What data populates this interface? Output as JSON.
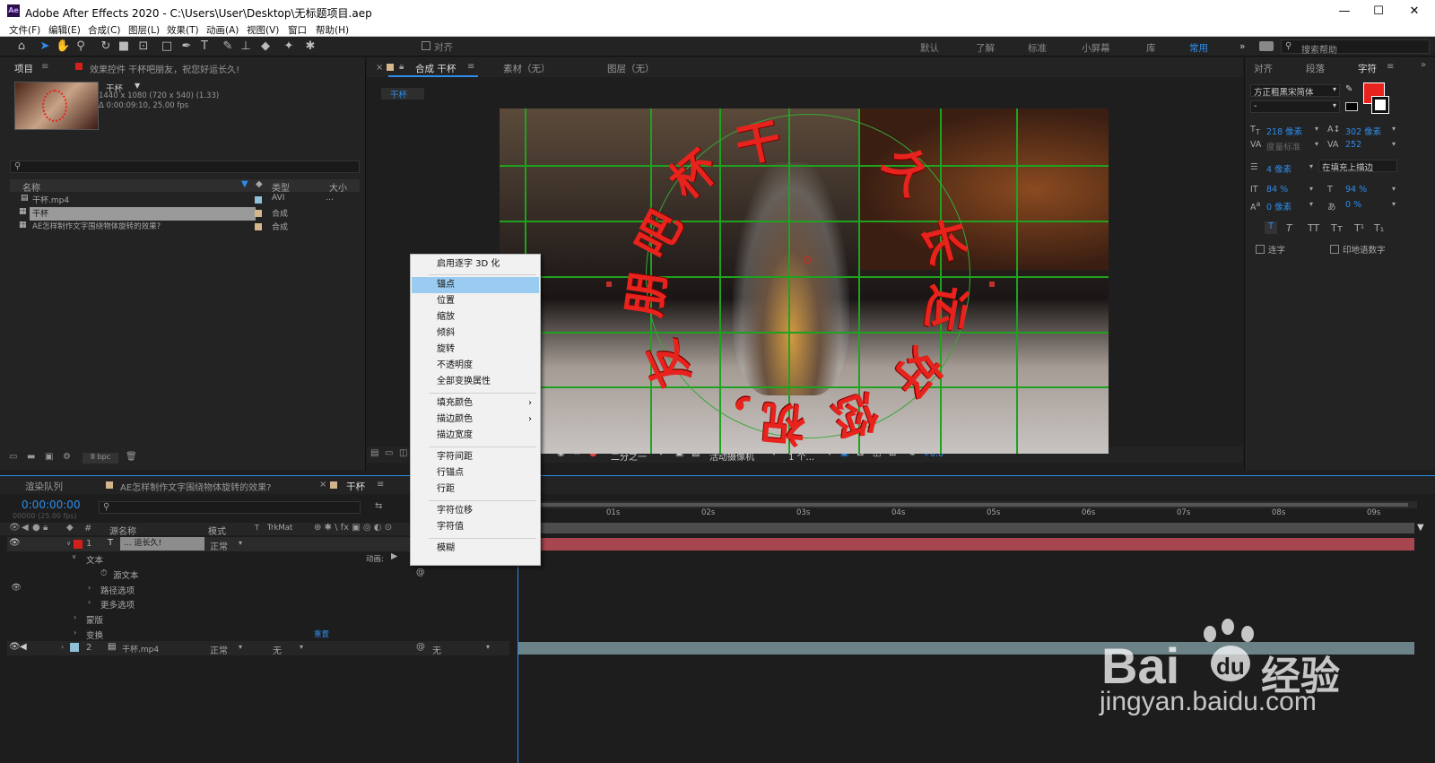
{
  "window": {
    "title": "Adobe After Effects 2020 - C:\\Users\\User\\Desktop\\无标题项目.aep",
    "app_badge": "Ae",
    "minimize": "—",
    "maximize": "☐",
    "close": "✕"
  },
  "menu": [
    "文件(F)",
    "编辑(E)",
    "合成(C)",
    "图层(L)",
    "效果(T)",
    "动画(A)",
    "视图(V)",
    "窗口",
    "帮助(H)"
  ],
  "toolbar": {
    "align_label": "对齐",
    "workspaces": [
      "默认",
      "了解",
      "标准",
      "小屏幕",
      "库",
      "常用"
    ],
    "workspaces_more": "»",
    "search_placeholder": "搜索帮助"
  },
  "project_panel": {
    "tab": "项目",
    "effects_tab": "效果控件 干杯吧朋友，祝您好运长久!",
    "item_name": "干杯",
    "item_info1": "1440 x 1080  (720 x 540) (1.33)",
    "item_info2": "Δ 0:00:09:10, 25.00 fps",
    "columns": [
      "名称",
      "类型",
      "大小"
    ],
    "items": [
      {
        "name": "干杯.mp4",
        "type": "AVI",
        "size": "…"
      },
      {
        "name": "干杯",
        "type": "合成",
        "size": ""
      },
      {
        "name": "AE怎样制作文字围绕物体旋转的效果?",
        "type": "合成",
        "size": ""
      }
    ],
    "bpc": "8 bpc"
  },
  "comp_panel": {
    "tabs": [
      "合成 干杯",
      "素材（无）",
      "图层（无）"
    ],
    "breadcrumb": "干杯",
    "zoom_label": "二分之一",
    "camera": "活动摄像机",
    "views": "1 个...",
    "exposure": "+0.0",
    "ring_text": [
      "干",
      "杯",
      "吧",
      "朋",
      "友",
      "，",
      "祝",
      "您",
      "好",
      "运",
      "长",
      "久"
    ]
  },
  "context_menu": {
    "items": [
      {
        "label": "启用逐字 3D 化",
        "sub": false
      },
      {
        "label": "锚点",
        "sub": false,
        "highlighted": true
      },
      {
        "label": "位置",
        "sub": false
      },
      {
        "label": "缩放",
        "sub": false
      },
      {
        "label": "倾斜",
        "sub": false
      },
      {
        "label": "旋转",
        "sub": false
      },
      {
        "label": "不透明度",
        "sub": false
      },
      {
        "label": "全部变换属性",
        "sub": false
      },
      {
        "label": "填充颜色",
        "sub": true
      },
      {
        "label": "描边颜色",
        "sub": true
      },
      {
        "label": "描边宽度",
        "sub": false
      },
      {
        "label": "字符间距",
        "sub": false
      },
      {
        "label": "行锚点",
        "sub": false
      },
      {
        "label": "行距",
        "sub": false
      },
      {
        "label": "字符位移",
        "sub": false
      },
      {
        "label": "字符值",
        "sub": false
      },
      {
        "label": "模糊",
        "sub": false
      }
    ],
    "sub_arrow": "›"
  },
  "right_panel": {
    "tabs": [
      "对齐",
      "段落",
      "字符"
    ],
    "font": "方正粗黑宋简体",
    "font_style": "-",
    "size": "218 像素",
    "leading": "302 像素",
    "kerning": "度量标准",
    "tracking": "252",
    "stroke": "4 像素",
    "stroke_mode": "在填充上描边",
    "vscale": "84 %",
    "hscale": "94 %",
    "baseline": "0 像素",
    "tsume": "0 %",
    "styles": [
      "T",
      "T",
      "TT",
      "Tт",
      "T¹",
      "T₁"
    ],
    "ligature": "连字",
    "hindi": "印地语数字",
    "fill_color": "#e8231d"
  },
  "timeline": {
    "tabs": [
      "渲染队列",
      "AE怎样制作文字围绕物体旋转的效果?",
      "干杯"
    ],
    "timecode": "0:00:00:00",
    "timecode_sub": "00000 (25.00 fps)",
    "columns": [
      "源名称",
      "模式",
      "T",
      "TrkMat"
    ],
    "layers": [
      {
        "num": "1",
        "name": "... 运长久!",
        "mode": "正常",
        "trkmat": ""
      },
      {
        "num": "2",
        "name": "干杯.mp4",
        "mode": "正常",
        "trkmat": "无",
        "parent": "无"
      }
    ],
    "sub_rows": [
      "文本",
      "源文本",
      "路径选项",
      "更多选项",
      "蒙版",
      "变换"
    ],
    "animate_label": "动画:",
    "reset_label": "重置",
    "ruler": [
      "01s",
      "02s",
      "03s",
      "04s",
      "05s",
      "06s",
      "07s",
      "08s",
      "09s"
    ]
  },
  "watermark": {
    "brand": "Bai",
    "brand2": "du",
    "product": "经验",
    "url": "jingyan.baidu.com"
  }
}
